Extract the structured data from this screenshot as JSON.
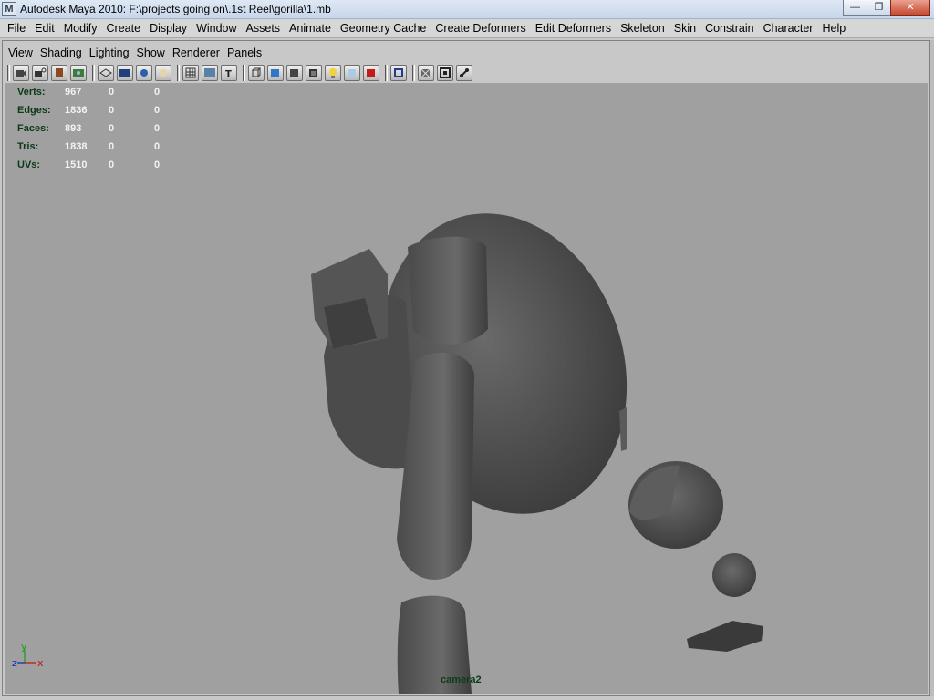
{
  "window": {
    "title": "Autodesk Maya 2010: F:\\projects going on\\.1st Reel\\gorilla\\1.mb",
    "app_icon_glyph": "M",
    "controls": {
      "minimize": "—",
      "maximize": "❐",
      "close": "✕"
    }
  },
  "menubar": {
    "items": [
      "File",
      "Edit",
      "Modify",
      "Create",
      "Display",
      "Window",
      "Assets",
      "Animate",
      "Geometry Cache",
      "Create Deformers",
      "Edit Deformers",
      "Skeleton",
      "Skin",
      "Constrain",
      "Character",
      "Help"
    ]
  },
  "panel_menu": {
    "items": [
      "View",
      "Shading",
      "Lighting",
      "Show",
      "Renderer",
      "Panels"
    ]
  },
  "toolbar_icons": [
    "select-camera-icon",
    "lock-camera-icon",
    "bookmark-icon",
    "image-plane-icon",
    "grid-icon",
    "film-gate-icon",
    "resolution-gate-icon",
    "gate-mask-icon",
    "field-chart-icon",
    "safe-action-icon",
    "safe-title-icon",
    "wireframe-icon",
    "smooth-shade-icon",
    "flat-shade-icon",
    "bounding-box-icon",
    "use-lights-icon",
    "xray-icon",
    "textured-icon",
    "isolate-select-icon",
    "wireframe-on-shaded-icon",
    "frame-all-icon",
    "joint-xray-icon"
  ],
  "hud": {
    "rows": [
      {
        "label": "Verts:",
        "v1": "967",
        "v2": "0",
        "v3": "0"
      },
      {
        "label": "Edges:",
        "v1": "1836",
        "v2": "0",
        "v3": "0"
      },
      {
        "label": "Faces:",
        "v1": "893",
        "v2": "0",
        "v3": "0"
      },
      {
        "label": "Tris:",
        "v1": "1838",
        "v2": "0",
        "v3": "0"
      },
      {
        "label": "UVs:",
        "v1": "1510",
        "v2": "0",
        "v3": "0"
      }
    ]
  },
  "viewport": {
    "camera_label": "camera2",
    "axis": {
      "x": "x",
      "y": "y",
      "z": "z"
    },
    "background": "#a0a0a0",
    "model_color": "#555555"
  }
}
